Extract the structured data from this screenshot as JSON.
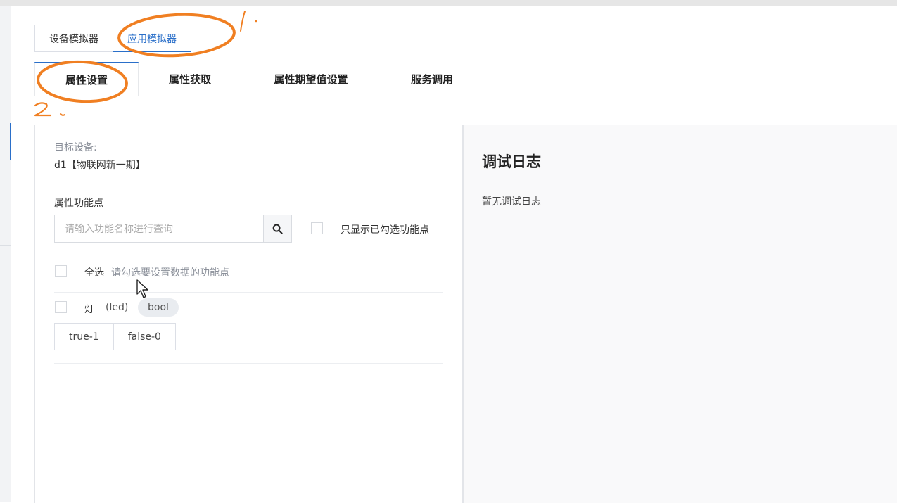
{
  "simulator_tabs": [
    "设备模拟器",
    "应用模拟器"
  ],
  "property_tabs": [
    "属性设置",
    "属性获取",
    "属性期望值设置",
    "服务调用"
  ],
  "target": {
    "label": "目标设备:",
    "device": "d1【物联网新一期】"
  },
  "features": {
    "label": "属性功能点",
    "search_placeholder": "请输入功能名称进行查询",
    "show_checked_label": "只显示已勾选功能点",
    "select_all_label": "全选",
    "select_hint": "请勾选要设置数据的功能点"
  },
  "property_item": {
    "name": "灯",
    "identifier": "(led)",
    "type": "bool",
    "options": [
      "true-1",
      "false-0"
    ]
  },
  "log": {
    "title": "调试日志",
    "empty": "暂无调试日志"
  },
  "annotations": {
    "mark1": "1.",
    "mark2": "2."
  },
  "colors": {
    "accent": "#2a6fc9",
    "annotation": "#f07f22"
  },
  "icons": {
    "search": "search-icon",
    "cursor": "mouse-cursor-icon"
  }
}
